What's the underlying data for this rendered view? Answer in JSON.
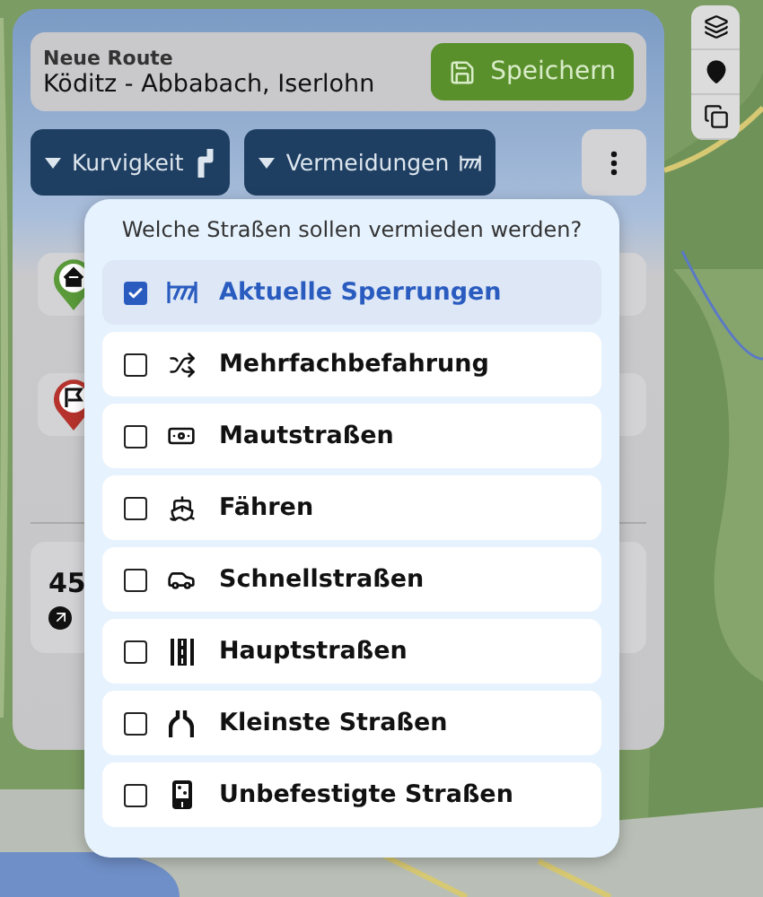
{
  "route": {
    "label": "Neue Route",
    "name": "Köditz - Abbabach, Iserlohn",
    "save": "Speichern"
  },
  "filters": [
    {
      "label": "Kurvigkeit"
    },
    {
      "label": "Vermeidungen"
    }
  ],
  "summary": {
    "distance": "45"
  },
  "avoid": {
    "title": "Welche Straßen sollen vermieden werden?",
    "items": [
      {
        "label": "Aktuelle Sperrungen",
        "checked": true
      },
      {
        "label": "Mehrfachbefahrung",
        "checked": false
      },
      {
        "label": "Mautstraßen",
        "checked": false
      },
      {
        "label": "Fähren",
        "checked": false
      },
      {
        "label": "Schnellstraßen",
        "checked": false
      },
      {
        "label": "Hauptstraßen",
        "checked": false
      },
      {
        "label": "Kleinste Straßen",
        "checked": false
      },
      {
        "label": "Unbefestigte Straßen",
        "checked": false
      }
    ]
  }
}
